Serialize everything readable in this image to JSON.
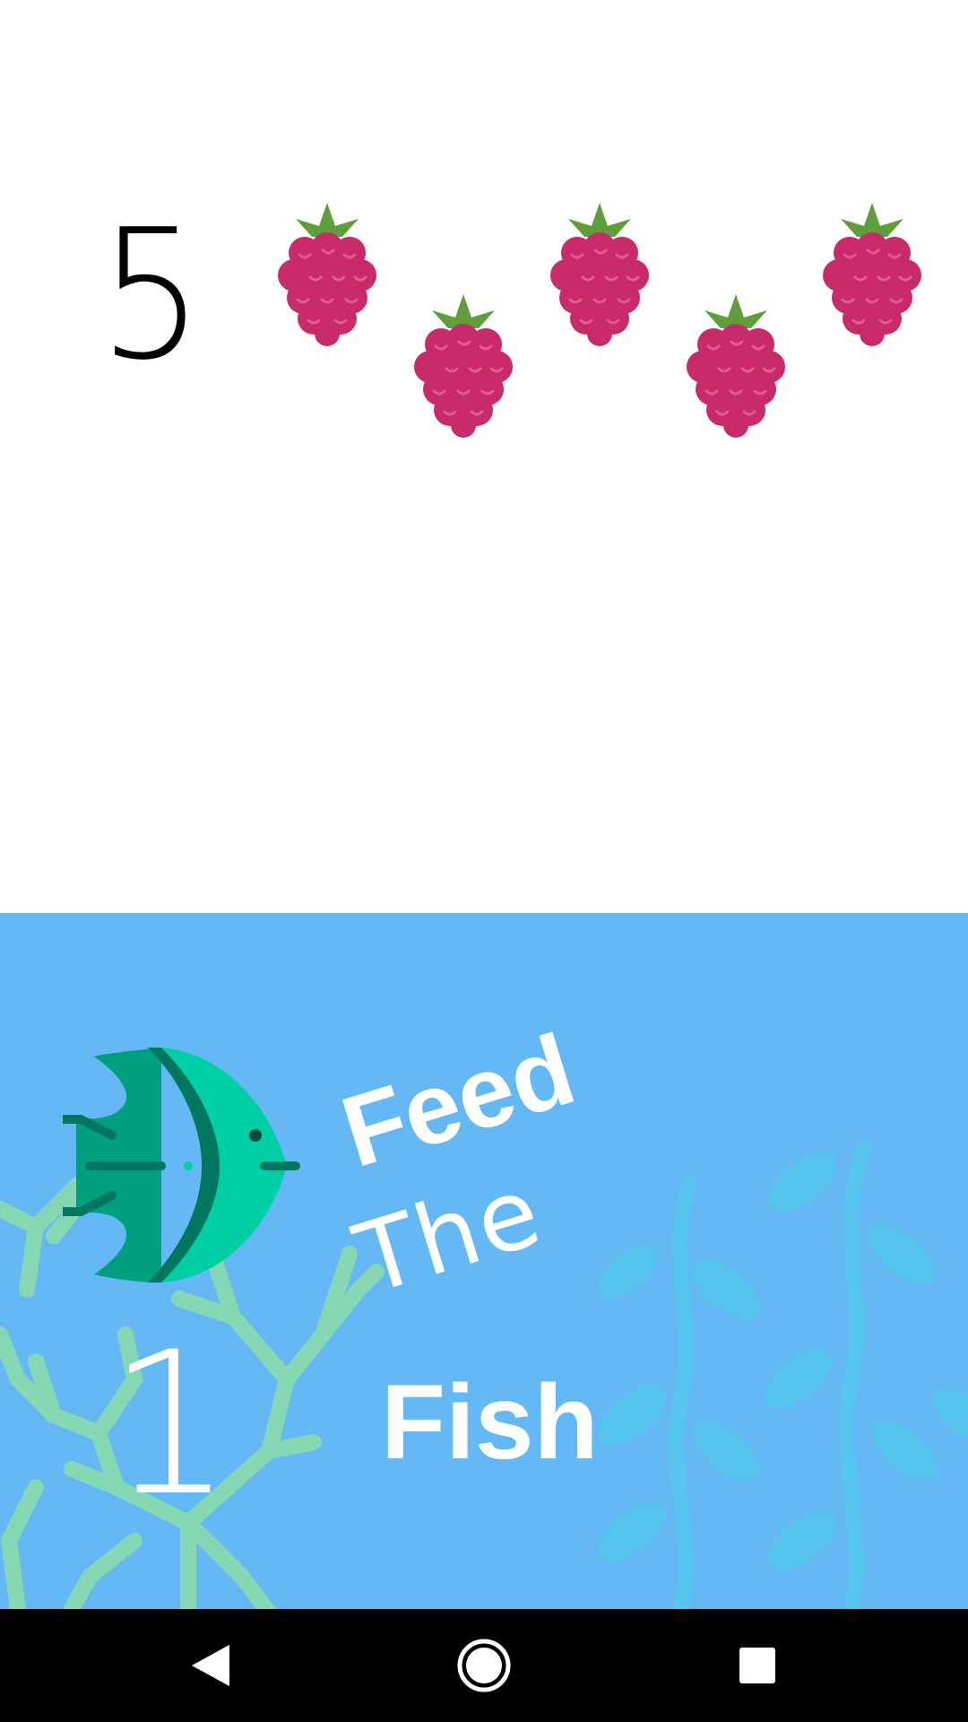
{
  "counter": {
    "number": "5",
    "item_count": 5,
    "item_icon": "raspberry-icon"
  },
  "game": {
    "number": "1",
    "title_words": [
      "Feed",
      "The",
      "Fish"
    ],
    "fish_icon": "fish-icon"
  },
  "colors": {
    "panel_bg": "#64b9f4",
    "raspberry": "#c82a6a",
    "leaf": "#5f9e3a",
    "coral": "#86d7b4",
    "seaweed": "#55c6ef",
    "fish_dark": "#00775f",
    "fish_mid": "#00a07f",
    "fish_light": "#00cfa5"
  },
  "navbar": {
    "back_icon": "back-icon",
    "home_icon": "home-icon",
    "recents_icon": "recents-icon"
  }
}
